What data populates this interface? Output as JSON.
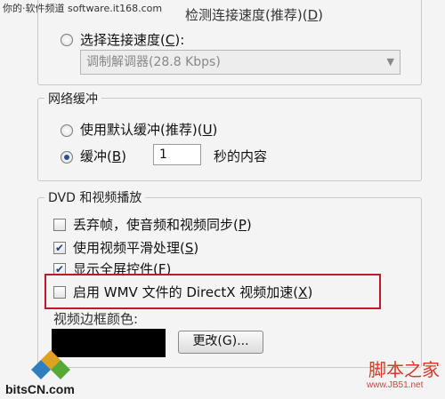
{
  "watermark_top": "你的·软件频道 software.it168.com",
  "connection": {
    "top_option_label": "检测连接速度(推荐)",
    "top_option_key": "D",
    "choose_speed_label": "选择连接速度(",
    "choose_speed_key": "C",
    "choose_speed_suffix": "):",
    "speed_value": "调制解调器(28.8 Kbps)"
  },
  "network_buffering": {
    "legend": "网络缓冲",
    "default_label": "使用默认缓冲(推荐)(",
    "default_key": "U",
    "default_suffix": ")",
    "buffer_label": "缓冲(",
    "buffer_key": "B",
    "buffer_suffix": ")",
    "buffer_value": "1",
    "buffer_unit": "秒的内容"
  },
  "dvd_playback": {
    "legend": "DVD 和视频播放",
    "drop_frames_label": "丢弃帧，使音频和视频同步(",
    "drop_frames_key": "P",
    "drop_frames_suffix": ")",
    "smoothing_label": "使用视频平滑处理(",
    "smoothing_key": "S",
    "smoothing_suffix": ")",
    "fullscreen_label": "显示全屏控件(",
    "fullscreen_key": "F",
    "fullscreen_suffix": ")",
    "directx_label": "启用 WMV 文件的 DirectX 视频加速(",
    "directx_key": "X",
    "directx_suffix": ")",
    "border_color_label": "视频边框颜色:",
    "change_button": "更改(G)..."
  },
  "logos": {
    "left": "bitsCN.com",
    "right": "脚本之家",
    "right_url": "www.JB51.net"
  },
  "colors": {
    "highlight": "#c0182a",
    "accent_check": "#253f78",
    "swatch": "#000000"
  }
}
